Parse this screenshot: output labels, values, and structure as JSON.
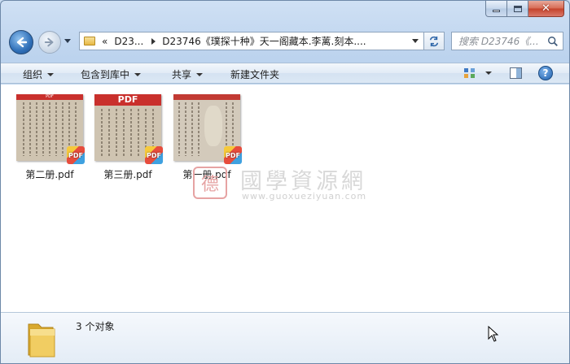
{
  "address": {
    "back_label": "‹",
    "chevrons": "«",
    "segment1": "D23...",
    "segment2": "D23746《璞探十种》天一阁藏本.李蓠.刻本...."
  },
  "search": {
    "placeholder": "搜索 D23746《..."
  },
  "toolbar": {
    "organize": "组织",
    "include_library": "包含到库中",
    "share": "共享",
    "new_folder": "新建文件夹"
  },
  "files": [
    {
      "name": "第二册.pdf",
      "badge": "PDF",
      "band": "PDF"
    },
    {
      "name": "第三册.pdf",
      "badge": "PDF",
      "band": "PDF"
    },
    {
      "name": "第一册.pdf",
      "badge": "PDF",
      "band": ""
    }
  ],
  "watermark": {
    "seal": "德",
    "title": "國學資源網",
    "url": "www.guoxueziyuan.com"
  },
  "details": {
    "count_text": "3 个对象"
  },
  "icons": [
    "back-arrow-icon",
    "forward-arrow-icon",
    "folder-icon",
    "refresh-icon",
    "search-icon",
    "view-icon",
    "preview-pane-icon",
    "help-icon",
    "pdf-badge-icon",
    "mouse-cursor-icon"
  ]
}
